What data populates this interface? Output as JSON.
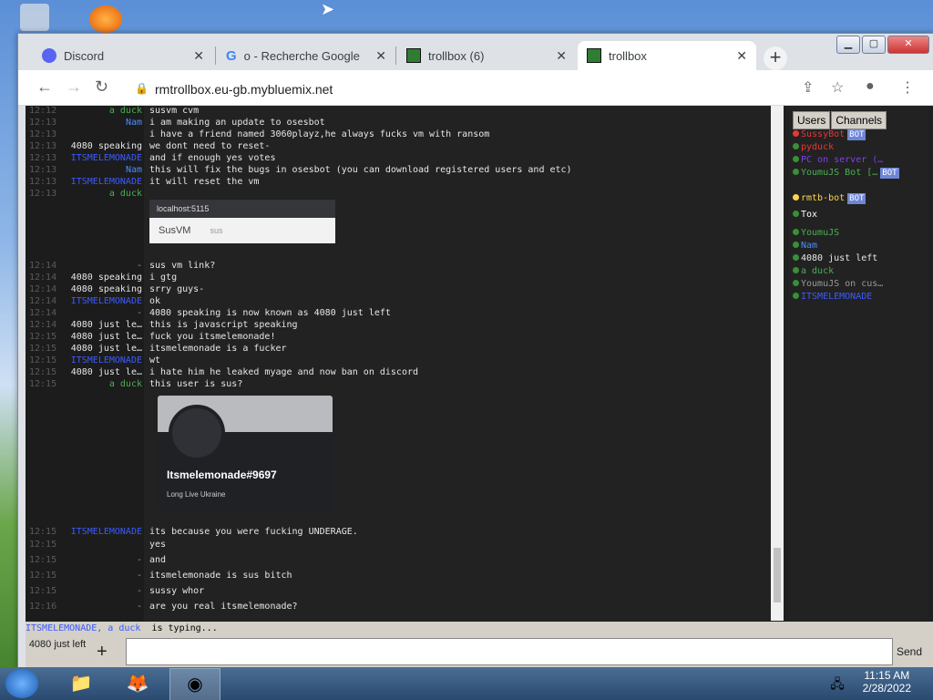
{
  "browser": {
    "tabs": [
      {
        "label": "Discord",
        "icon": "discord-icon"
      },
      {
        "label": "o - Recherche Google",
        "icon": "google-icon"
      },
      {
        "label": "trollbox (6)",
        "icon": "trollbox-icon"
      },
      {
        "label": "trollbox",
        "icon": "trollbox-icon"
      }
    ],
    "url": "rmtrollbox.eu-gb.mybluemix.net"
  },
  "chat": {
    "rows": [
      {
        "time": "12:12",
        "nick": "a duck",
        "color": "#4caf50",
        "msg": "susvm cvm"
      },
      {
        "time": "12:13",
        "nick": "Nam",
        "color": "#4a8cff",
        "msg": "i am making an update to osesbot"
      },
      {
        "time": "12:13",
        "nick": "",
        "color": "#999",
        "msg": "i have a friend named 3060playz,he always fucks vm with ransom"
      },
      {
        "time": "12:13",
        "nick": "4080 speaking",
        "color": "#e6e6e6",
        "msg": "we dont need to reset-"
      },
      {
        "time": "12:13",
        "nick": "ITSMELEMONADE",
        "color": "#3b5bff",
        "msg": "and if enough yes votes"
      },
      {
        "time": "12:13",
        "nick": "Nam",
        "color": "#4a8cff",
        "msg": "this will fix the bugs in osesbot (you can download registered users and etc)"
      },
      {
        "time": "12:13",
        "nick": "ITSMELEMONADE",
        "color": "#3b5bff",
        "msg": "it will reset the vm"
      },
      {
        "time": "12:13",
        "nick": "a duck",
        "color": "#4caf50",
        "msg": ""
      },
      {
        "time": "12:14",
        "nick": "-",
        "color": "#999",
        "msg": "sus vm link?"
      },
      {
        "time": "12:14",
        "nick": "4080 speaking",
        "color": "#e6e6e6",
        "msg": "i gtg"
      },
      {
        "time": "12:14",
        "nick": "4080 speaking",
        "color": "#e6e6e6",
        "msg": "srry guys-"
      },
      {
        "time": "12:14",
        "nick": "ITSMELEMONADE",
        "color": "#3b5bff",
        "msg": "ok"
      },
      {
        "time": "12:14",
        "nick": "-",
        "color": "#999",
        "msg": "4080 speaking is now known as 4080 just left"
      },
      {
        "time": "12:14",
        "nick": "4080 just le…",
        "color": "#e6e6e6",
        "msg": "this is javascript speaking"
      },
      {
        "time": "12:15",
        "nick": "4080 just le…",
        "color": "#e6e6e6",
        "msg": "fuck you itsmelemonade!"
      },
      {
        "time": "12:15",
        "nick": "4080 just le…",
        "color": "#e6e6e6",
        "msg": "itsmelemonade is a fucker"
      },
      {
        "time": "12:15",
        "nick": "ITSMELEMONADE",
        "color": "#3b5bff",
        "msg": "wt"
      },
      {
        "time": "12:15",
        "nick": "4080 just le…",
        "color": "#e6e6e6",
        "msg": "i hate him he leaked myage and now ban on discord"
      },
      {
        "time": "12:15",
        "nick": "a duck",
        "color": "#4caf50",
        "msg": "this user is sus?"
      },
      {
        "time": "12:15",
        "nick": "ITSMELEMONADE",
        "color": "#3b5bff",
        "msg": "its because you were fucking UNDERAGE."
      },
      {
        "time": "12:15",
        "nick": "",
        "color": "#999",
        "msg": "yes"
      },
      {
        "time": "12:15",
        "nick": "-",
        "color": "#999",
        "msg": "and"
      },
      {
        "time": "12:15",
        "nick": "-",
        "color": "#999",
        "msg": "itsmelemonade is sus bitch"
      },
      {
        "time": "12:15",
        "nick": "-",
        "color": "#999",
        "msg": "sussy whor"
      },
      {
        "time": "12:16",
        "nick": "-",
        "color": "#999",
        "msg": "are you real itsmelemonade?"
      }
    ],
    "embed1": {
      "url": "localhost:5115",
      "title": "SusVM",
      "sub": "sus"
    },
    "embed2": {
      "username": "Itsmelemonade#9697",
      "status": "Long Live Ukraine"
    }
  },
  "sidebar": {
    "tabs": [
      "Users",
      "Channels"
    ],
    "users": [
      {
        "name": "SussyBot",
        "color": "#e53935",
        "bot": true,
        "dot": "#e53935"
      },
      {
        "name": "pyduck",
        "color": "#e53935",
        "bot": false,
        "dot": "#3a8f3a"
      },
      {
        "name": "PC on server (…",
        "color": "#7b3ff2",
        "bot": false,
        "dot": "#3a8f3a"
      },
      {
        "name": "YoumuJS Bot […",
        "color": "#4caf50",
        "bot": true,
        "dot": "#3a8f3a"
      },
      {
        "name": "rmtb-bot",
        "color": "#ffd54f",
        "bot": true,
        "dot": "#ffd54f"
      },
      {
        "name": "Tox",
        "color": "#ffffff",
        "bot": false,
        "dot": "#3a8f3a"
      },
      {
        "name": "YoumuJS",
        "color": "#4caf50",
        "bot": false,
        "dot": "#3a8f3a"
      },
      {
        "name": "Nam",
        "color": "#4a8cff",
        "bot": false,
        "dot": "#3a8f3a"
      },
      {
        "name": "4080 just left",
        "color": "#e6e6e6",
        "bot": false,
        "dot": "#3a8f3a"
      },
      {
        "name": "a duck",
        "color": "#4caf50",
        "bot": false,
        "dot": "#3a8f3a"
      },
      {
        "name": "YoumuJS on cus…",
        "color": "#999999",
        "bot": false,
        "dot": "#3a8f3a"
      },
      {
        "name": "ITSMELEMONADE",
        "color": "#3b5bff",
        "bot": false,
        "dot": "#3a8f3a"
      }
    ],
    "bot_label": "BOT"
  },
  "typing": {
    "names": "ITSMELEMONADE, a duck",
    "suffix": "is typing..."
  },
  "input": {
    "nick": "4080 just left",
    "plus": "+",
    "send": "Send",
    "value": ""
  },
  "taskbar": {
    "time": "11:15 AM",
    "date": "2/28/2022"
  }
}
